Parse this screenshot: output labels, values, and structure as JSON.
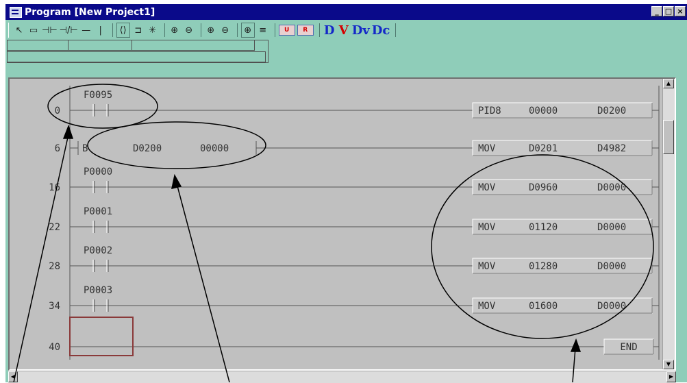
{
  "window": {
    "title": "Program [New Project1]",
    "buttons": [
      "_",
      "□",
      "×"
    ]
  },
  "toolbar": {
    "items": [
      {
        "icon": "select-arrow-icon",
        "glyph": "↖"
      },
      {
        "icon": "rectangle-icon",
        "glyph": "▭"
      },
      {
        "icon": "normally-open-contact-icon",
        "glyph": "⊣⊢"
      },
      {
        "icon": "normally-closed-contact-icon",
        "glyph": "⊣/⊢"
      },
      {
        "icon": "horizontal-line-icon",
        "glyph": "—"
      },
      {
        "icon": "vertical-line-icon",
        "glyph": "|"
      },
      {
        "icon": "coil-icon",
        "glyph": "⟨⟩"
      },
      {
        "icon": "function-icon",
        "glyph": "⊐"
      },
      {
        "icon": "delete-icon",
        "glyph": "✳"
      },
      {
        "icon": "zoom-in-icon",
        "glyph": "⊕"
      },
      {
        "icon": "zoom-out-icon",
        "glyph": "⊖"
      },
      {
        "icon": "zoom-in-2-icon",
        "glyph": "⊕"
      },
      {
        "icon": "zoom-out-2-icon",
        "glyph": "⊖"
      },
      {
        "icon": "zoom-fit-icon",
        "glyph": "⊕"
      },
      {
        "icon": "align-icon",
        "glyph": "≡"
      }
    ],
    "badges": [
      "U",
      "R"
    ],
    "letters": [
      "D",
      "V",
      "Dv",
      "Dc"
    ]
  },
  "ladder": {
    "rows": [
      {
        "step": "0",
        "contact": "F0095",
        "instruction": "PID8",
        "op1": "00000",
        "op2": "D0200"
      },
      {
        "step": "6",
        "contact": "",
        "inline_label": "B",
        "inline_op1": "D0200",
        "inline_op2": "00000",
        "instruction": "MOV",
        "op1": "D0201",
        "op2": "D4982"
      },
      {
        "step": "16",
        "contact": "P0000",
        "instruction": "MOV",
        "op1": "D0960",
        "op2": "D0000"
      },
      {
        "step": "22",
        "contact": "P0001",
        "instruction": "MOV",
        "op1": "01120",
        "op2": "D0000"
      },
      {
        "step": "28",
        "contact": "P0002",
        "instruction": "MOV",
        "op1": "01280",
        "op2": "D0000"
      },
      {
        "step": "34",
        "contact": "P0003",
        "instruction": "MOV",
        "op1": "01600",
        "op2": "D0000"
      },
      {
        "step": "40",
        "contact": "",
        "instruction": "END",
        "op1": "",
        "op2": ""
      }
    ]
  },
  "colors": {
    "titlebar": "#0a0a8a",
    "window_bg": "#8fcdb9",
    "editor_bg": "#c0c0c0",
    "cursor_box": "#8a3a3a"
  }
}
